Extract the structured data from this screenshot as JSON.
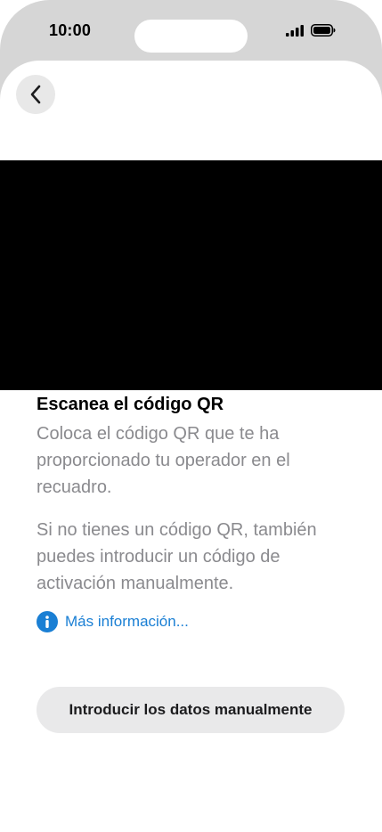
{
  "status_bar": {
    "time": "10:00"
  },
  "nav": {
    "back_icon": "chevron-left-icon"
  },
  "camera": {
    "state": "black-preview"
  },
  "content": {
    "title": "Escanea el código QR",
    "description": "Coloca el código QR que te ha proporcionado tu operador en el recuadro.",
    "secondary": "Si no tienes un código QR, también puedes introducir un código de activación manualmente.",
    "info_link": "Más información...",
    "info_icon": "info-icon"
  },
  "actions": {
    "manual_button": "Introducir los datos manualmente"
  },
  "colors": {
    "link": "#1a7fd4",
    "secondary_text": "#8a8a8e",
    "button_bg": "#e9e9ea"
  }
}
